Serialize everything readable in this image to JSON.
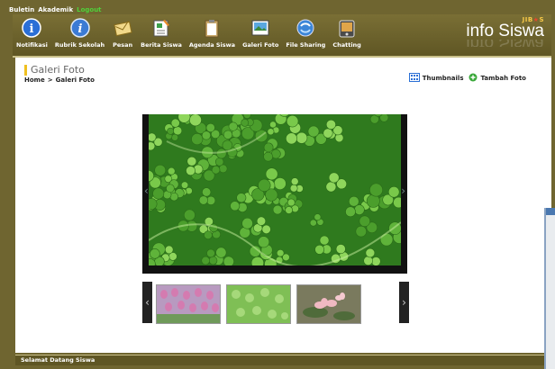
{
  "topbar": {
    "buletin": "Buletin",
    "akademik": "Akademik",
    "logout": "Logout"
  },
  "nav": {
    "items": [
      {
        "label": "Notifikasi",
        "icon": "info-icon"
      },
      {
        "label": "Rubrik Sekolah",
        "icon": "rubrik-icon"
      },
      {
        "label": "Pesan",
        "icon": "envelope-icon"
      },
      {
        "label": "Berita Siswa",
        "icon": "news-icon"
      },
      {
        "label": "Agenda Siswa",
        "icon": "clipboard-icon"
      },
      {
        "label": "Galeri Foto",
        "icon": "gallery-icon"
      },
      {
        "label": "File Sharing",
        "icon": "file-sharing-icon"
      },
      {
        "label": "Chatting",
        "icon": "chat-icon"
      }
    ]
  },
  "brand": {
    "jib_prefix": "JIB",
    "jib_suffix": "S",
    "name": "info Siswa"
  },
  "page": {
    "title": "Galeri Foto",
    "breadcrumb_home": "Home",
    "breadcrumb_sep": ">",
    "breadcrumb_current": "Galeri Foto"
  },
  "actions": {
    "thumbnails": "Thumbnails",
    "add_photo": "Tambah Foto"
  },
  "viewer": {
    "prev": "‹",
    "next": "›"
  },
  "thumbstrip": {
    "prev": "‹",
    "next": "›",
    "thumbs": [
      "tulips-thumbnail",
      "clover-thumbnail",
      "water-lily-thumbnail"
    ]
  },
  "status": {
    "text": "Selamat Datang Siswa"
  },
  "colors": {
    "frame": "#6f6530",
    "accent": "#f0c020",
    "logout": "#4fd13a"
  }
}
